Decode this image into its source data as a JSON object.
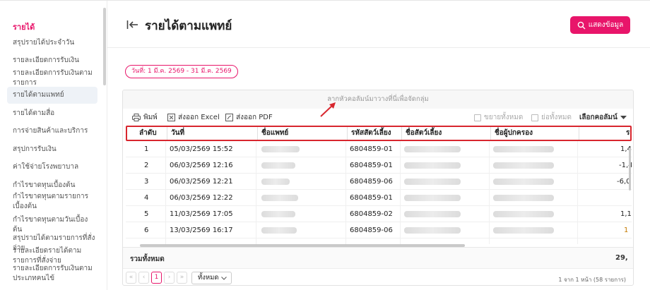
{
  "sidebar": {
    "title": "รายได้",
    "items": [
      {
        "label": "สรุปรายได้ประจำวัน"
      },
      {
        "label": "รายละเอียดการรับเงิน"
      },
      {
        "label": "รายละเอียดการรับเงินตามรายการ"
      },
      {
        "label": "รายได้ตามแพทย์"
      },
      {
        "label": "รายได้ตามสื่อ"
      },
      {
        "label": "การจ่ายสินค้าและบริการ"
      },
      {
        "label": "สรุปการรับเงิน"
      },
      {
        "label": "ค่าใช้จ่ายโรงพยาบาล"
      },
      {
        "label": "กำไรขาดทุนเบื้องต้น"
      },
      {
        "label": "กำไรขาดทุนตามรายการเบื้องต้น"
      },
      {
        "label": "กำไรขาดทุนตามวันเบื้องต้น"
      },
      {
        "label": "สรุปรายได้ตามรายการที่สั่งจ่าย"
      },
      {
        "label": "รายละเอียดรายได้ตามรายการที่สั่งจ่าย"
      },
      {
        "label": "รายละเอียดการรับเงินตามประเภทคนไข้"
      }
    ]
  },
  "header": {
    "title": "รายได้ตามแพทย์",
    "show_button": "แสดงข้อมูล",
    "date_range": "วันที่: 1 มี.ค. 2569 - 31 มี.ค. 2569"
  },
  "grid": {
    "group_hint": "ลากหัวคอลัมน์มาวางที่นี่เพื่อจัดกลุ่ม",
    "toolbar": {
      "print": "พิมพ์",
      "excel": "ส่งออก Excel",
      "pdf": "ส่งออก PDF",
      "expand_all": "ขยายทั้งหมด",
      "collapse_all": "ย่อทั้งหมด",
      "choose_columns": "เลือกคอลัมน์"
    },
    "columns": [
      "ลำดับ",
      "วันที่",
      "ชื่อแพทย์",
      "รหัสสัตว์เลี้ยง",
      "ชื่อสัตว์เลี้ยง",
      "ชื่อผู้ปกครอง",
      "ร"
    ],
    "rows": [
      {
        "no": "1",
        "date": "05/03/2569 15:52",
        "pet_id": "6804859-01",
        "amount": "1,4"
      },
      {
        "no": "2",
        "date": "06/03/2569 12:16",
        "pet_id": "6804859-01",
        "amount": "-1,4"
      },
      {
        "no": "3",
        "date": "06/03/2569 12:21",
        "pet_id": "6804859-06",
        "amount": "-6,0"
      },
      {
        "no": "4",
        "date": "06/03/2569 12:22",
        "pet_id": "6804859-01",
        "amount": ""
      },
      {
        "no": "5",
        "date": "11/03/2569 17:05",
        "pet_id": "6804859-02",
        "amount": "1,1"
      },
      {
        "no": "6",
        "date": "13/03/2569 16:17",
        "pet_id": "6804859-06",
        "amount": "1"
      }
    ],
    "total_label": "รวมทั้งหมด",
    "total_value": "29,",
    "pager": {
      "first": "«",
      "prev": "‹",
      "current": "1",
      "next": "›",
      "last": "»",
      "page_size": "ทั้งหมด",
      "info": "1 จาก 1 หน้า (58 รายการ)"
    }
  },
  "colors": {
    "accent": "#e8156a",
    "highlight": "#d8262e"
  }
}
